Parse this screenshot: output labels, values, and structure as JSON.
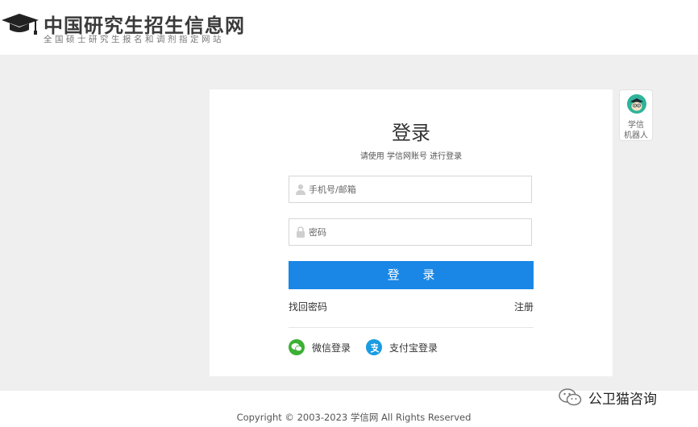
{
  "header": {
    "site_title": "中国研究生招生信息网",
    "site_subtitle": "全国硕士研究生报名和调剂指定网站"
  },
  "login": {
    "title": "登录",
    "subtitle": "请使用 学信网账号 进行登录",
    "username_placeholder": "手机号/邮箱",
    "password_placeholder": "密码",
    "submit_label": "登 录",
    "forgot_label": "找回密码",
    "register_label": "注册",
    "wechat_label": "微信登录",
    "alipay_label": "支付宝登录"
  },
  "robot": {
    "line1": "学信",
    "line2": "机器人"
  },
  "footer": {
    "copyright": "Copyright © 2003-2023 学信网 All Rights Reserved"
  },
  "watermark": {
    "text": "公卫猫咨询"
  },
  "colors": {
    "primary": "#1a87e6",
    "page_bg": "#efefef",
    "wechat": "#3cb034",
    "alipay": "#1a9be2"
  },
  "icons": {
    "logo": "graduation-cap-icon",
    "username": "user-icon",
    "password": "lock-icon",
    "wechat": "wechat-icon",
    "alipay": "alipay-icon",
    "robot": "robot-avatar-icon",
    "watermark": "wechat-outline-icon"
  }
}
